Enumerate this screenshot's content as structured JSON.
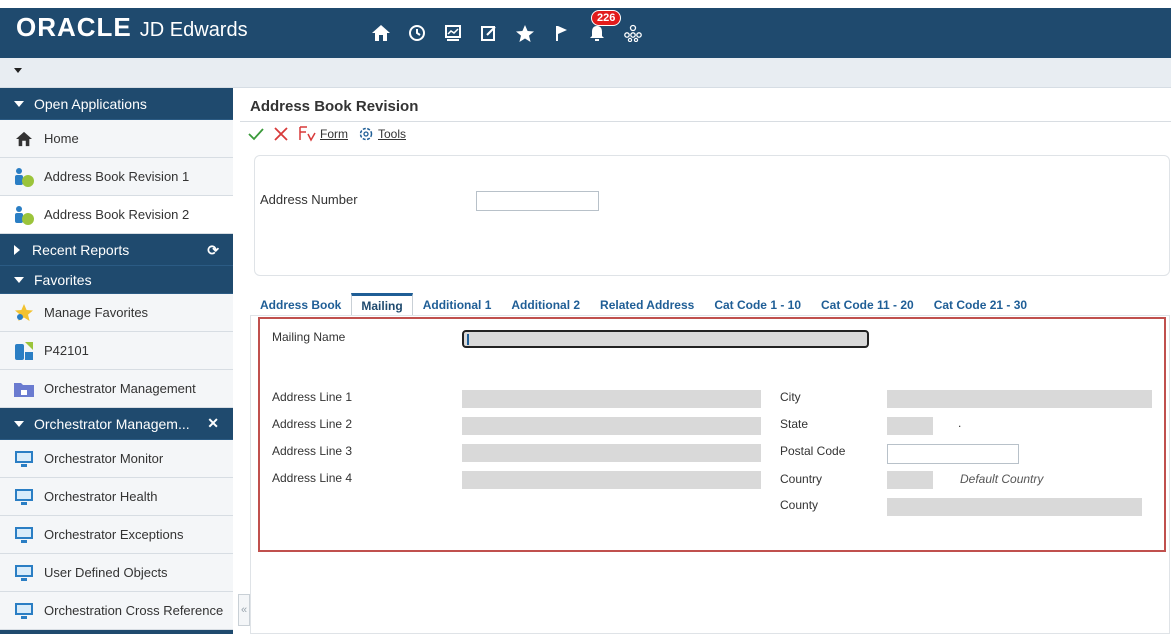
{
  "header": {
    "brand": "ORACLE",
    "product": "JD Edwards",
    "notification_count": "226",
    "icons": [
      "home-icon",
      "recent-icon",
      "dashboard-icon",
      "edit-icon",
      "favorites-icon",
      "flag-icon",
      "bell-icon",
      "org-icon"
    ]
  },
  "sidebar": {
    "open_apps_title": "Open Applications",
    "open_apps": [
      {
        "label": "Home"
      },
      {
        "label": "Address Book Revision 1"
      },
      {
        "label": "Address Book Revision 2"
      }
    ],
    "recent_reports_title": "Recent Reports",
    "favorites_title": "Favorites",
    "favorites": [
      {
        "label": "Manage Favorites"
      },
      {
        "label": "P42101"
      },
      {
        "label": "Orchestrator Management"
      }
    ],
    "orch_title": "Orchestrator Managem...",
    "orch_items": [
      {
        "label": "Orchestrator Monitor"
      },
      {
        "label": "Orchestrator Health"
      },
      {
        "label": "Orchestrator Exceptions"
      },
      {
        "label": "User Defined Objects"
      },
      {
        "label": "Orchestration Cross Reference"
      }
    ]
  },
  "main": {
    "title": "Address Book Revision",
    "toolbar": {
      "form": "Form",
      "tools": "Tools"
    },
    "address_number_label": "Address Number",
    "address_number_value": "",
    "tabs": [
      "Address Book",
      "Mailing",
      "Additional 1",
      "Additional 2",
      "Related Address",
      "Cat Code 1 - 10",
      "Cat Code 11 - 20",
      "Cat Code 21 - 30"
    ],
    "active_tab": "Mailing",
    "mailing": {
      "mailing_name_label": "Mailing Name",
      "address_line_1": "Address Line 1",
      "address_line_2": "Address Line 2",
      "address_line_3": "Address Line 3",
      "address_line_4": "Address Line 4",
      "city": "City",
      "state": "State",
      "state_dot": ".",
      "postal_code": "Postal Code",
      "country": "Country",
      "country_default": "Default Country",
      "county": "County"
    }
  },
  "colors": {
    "nav_bg": "#1f4a6e",
    "accent": "#1f5e96",
    "highlight_box": "#c0504d",
    "badge": "#e21b1b"
  }
}
